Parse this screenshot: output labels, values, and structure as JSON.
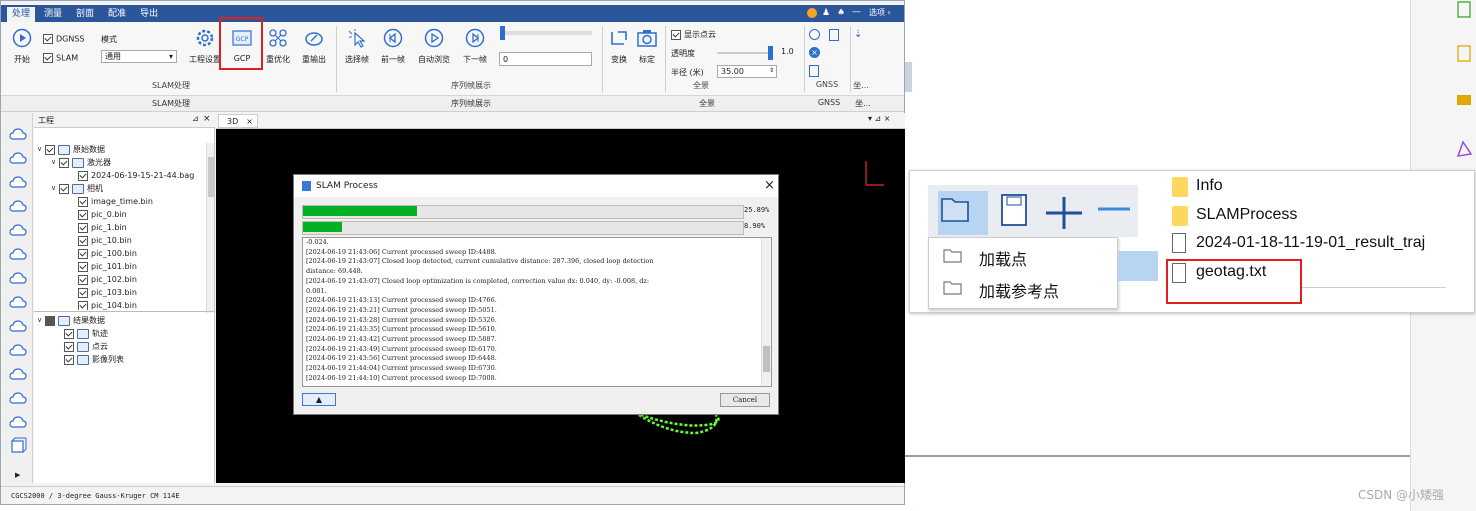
{
  "menu": {
    "tabs": [
      "处理",
      "测量",
      "剖面",
      "配准",
      "导出"
    ],
    "right": "选项"
  },
  "ribbon": {
    "start": "开始",
    "dgnss": "DGNSS",
    "slam": "SLAM",
    "mode_label": "模式",
    "mode_value": "通用",
    "project_settings": "工程设置",
    "gcp": "GCP",
    "gcp_icon_text": "GCP",
    "reoptimize": "重优化",
    "reoutput": "重输出",
    "select_frame": "选择帧",
    "prev_frame": "前一帧",
    "auto_browse": "自动浏览",
    "next_frame": "下一帧",
    "frame_input": "0",
    "transform": "变换",
    "calibrate": "标定",
    "show_pointcloud": "显示点云",
    "opacity_label": "透明度",
    "opacity_value": "1.0",
    "radius_label": "半径 (米)",
    "radius_value": "35.00",
    "group_slam": "SLAM处理",
    "group_seq": "序列帧展示",
    "group_global": "全景",
    "group_gnss": "GNSS",
    "group_coord": "坐..."
  },
  "ribbon2": {
    "slam": "SLAM处理",
    "seq": "序列帧展示",
    "global": "全景",
    "gnss": "GNSS",
    "coord": "坐..."
  },
  "panel": {
    "title": "工程",
    "tree": [
      {
        "label": "原始数据"
      },
      {
        "label": "激光器"
      },
      {
        "label": "2024-06-19-15-21-44.bag"
      },
      {
        "label": "相机"
      },
      {
        "label": "image_time.bin"
      },
      {
        "label": "pic_0.bin"
      },
      {
        "label": "pic_1.bin"
      },
      {
        "label": "pic_10.bin"
      },
      {
        "label": "pic_100.bin"
      },
      {
        "label": "pic_101.bin"
      },
      {
        "label": "pic_102.bin"
      },
      {
        "label": "pic_103.bin"
      },
      {
        "label": "pic_104.bin"
      },
      {
        "label": "结果数据"
      },
      {
        "label": "轨迹"
      },
      {
        "label": "点云"
      },
      {
        "label": "影像列表"
      }
    ]
  },
  "view": {
    "tab": "3D"
  },
  "status": "CGCS2000 / 3-degree Gauss-Kruger CM 114E",
  "dialog": {
    "title": "SLAM Process",
    "progress1": 25.89,
    "progress1_text": "25.89%",
    "progress2": 8.9,
    "progress2_text": "8.90%",
    "log": [
      "-0.024.",
      "[2024-06-19 21:43:06] Current processed sweep ID:4488.",
      "[2024-06-19 21:43:07] Closed loop detected, current cumulative distance: 287.396, closed loop detection",
      "distance: 69.448.",
      "[2024-06-19 21:43:07] Closed loop optimization is completed, correction value dx: 0.040, dy: -0.008, dz:",
      "0.001.",
      "[2024-06-19 21:43:13] Current processed sweep ID:4766.",
      "[2024-06-19 21:43:21] Current processed sweep ID:5051.",
      "[2024-06-19 21:43:28] Current processed sweep ID:5326.",
      "[2024-06-19 21:43:35] Current processed sweep ID:5610.",
      "[2024-06-19 21:43:42] Current processed sweep ID:5887.",
      "[2024-06-19 21:43:49] Current processed sweep ID:6170.",
      "[2024-06-19 21:43:56] Current processed sweep ID:6448.",
      "[2024-06-19 21:44:04] Current processed sweep ID:6730.",
      "[2024-06-19 21:44:10] Current processed sweep ID:7008."
    ],
    "cancel": "Cancel"
  },
  "snippet": {
    "menu": [
      "加载点",
      "加载参考点"
    ],
    "files": [
      "Info",
      "SLAMProcess",
      "2024-01-18-11-19-01_result_traj",
      "geotag.txt"
    ]
  },
  "watermark": "CSDN @小矮强",
  "colors": {
    "menubar": "#2b579a",
    "progress": "#06b025",
    "highlight": "#e02020",
    "trajectory": "#66ff33"
  }
}
